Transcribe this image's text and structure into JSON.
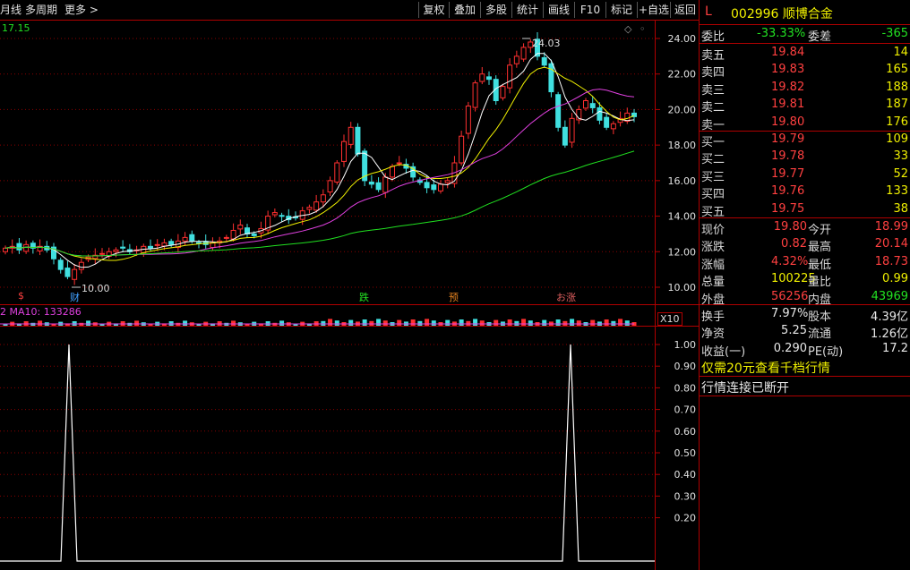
{
  "toolbar": {
    "left_items": [
      "月线",
      "多周期",
      "更多 >"
    ],
    "buttons": [
      "复权",
      "叠加",
      "多股",
      "统计",
      "画线",
      "F10",
      "标记",
      "+自选",
      "返回"
    ]
  },
  "main_chart": {
    "price_label": "17.15",
    "y_ticks": [
      "24.00",
      "22.00",
      "20.00",
      "18.00",
      "16.00",
      "14.00",
      "12.00",
      "10.00"
    ],
    "high_marker": "24.03",
    "low_marker": "10.00",
    "event_markers": [
      "$",
      "财",
      "跌",
      "预",
      "お涨"
    ],
    "icon": "diamond-icon"
  },
  "volume_panel": {
    "label": "2  MA10: 133286",
    "zoom_label": "X10"
  },
  "indicator_panel": {
    "y_ticks": [
      "1.00",
      "0.90",
      "0.80",
      "0.70",
      "0.60",
      "0.50",
      "0.40",
      "0.30",
      "0.20"
    ],
    "peaks": [
      1.0,
      1.0
    ]
  },
  "quote": {
    "prefix": "L",
    "code_name": "002996 顺博合金",
    "weibi": {
      "label": "委比",
      "value": "-33.33%",
      "label2": "委差",
      "value2": "-365"
    },
    "sell": [
      {
        "label": "卖五",
        "price": "19.84",
        "vol": "14"
      },
      {
        "label": "卖四",
        "price": "19.83",
        "vol": "165"
      },
      {
        "label": "卖三",
        "price": "19.82",
        "vol": "188"
      },
      {
        "label": "卖二",
        "price": "19.81",
        "vol": "187"
      },
      {
        "label": "卖一",
        "price": "19.80",
        "vol": "176"
      }
    ],
    "buy": [
      {
        "label": "买一",
        "price": "19.79",
        "vol": "109"
      },
      {
        "label": "买二",
        "price": "19.78",
        "vol": "33"
      },
      {
        "label": "买三",
        "price": "19.77",
        "vol": "52"
      },
      {
        "label": "买四",
        "price": "19.76",
        "vol": "133"
      },
      {
        "label": "买五",
        "price": "19.75",
        "vol": "38"
      }
    ],
    "stats": [
      {
        "l1": "现价",
        "v1": "19.80",
        "l2": "今开",
        "v2": "18.99"
      },
      {
        "l1": "涨跌",
        "v1": "0.82",
        "l2": "最高",
        "v2": "20.14"
      },
      {
        "l1": "涨幅",
        "v1": "4.32%",
        "l2": "最低",
        "v2": "18.73"
      },
      {
        "l1": "总量",
        "v1": "100225",
        "l2": "量比",
        "v2": "0.99"
      },
      {
        "l1": "外盘",
        "v1": "56256",
        "l2": "内盘",
        "v2": "43969"
      }
    ],
    "extra": [
      {
        "l1": "换手",
        "v1": "7.97%",
        "l2": "股本",
        "v2": "4.39亿"
      },
      {
        "l1": "净资",
        "v1": "5.25",
        "l2": "流通",
        "v2": "1.26亿"
      },
      {
        "l1": "收益(一)",
        "v1": "0.290",
        "l2": "PE(动)",
        "v2": "17.2"
      }
    ],
    "promo": "仅需20元查看千档行情",
    "status": "行情连接已断开"
  },
  "colors": {
    "up": "#ff3030",
    "down": "#40e0e0",
    "ma5": "#ffffff",
    "ma10": "#f0f000",
    "ma20": "#e040e0",
    "ma60": "#20e020",
    "grid": "#8a0000"
  }
}
